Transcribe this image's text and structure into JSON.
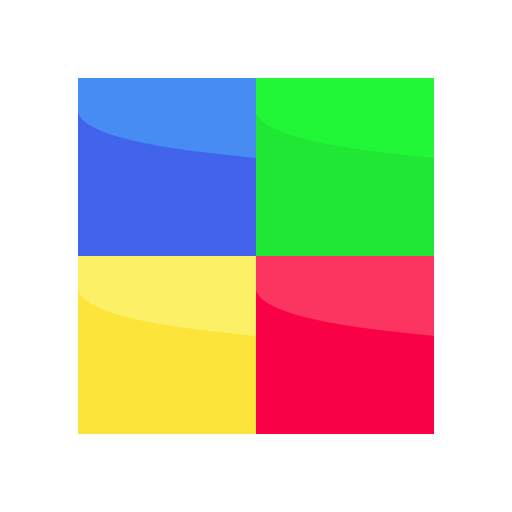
{
  "app_icon": {
    "icon": "four-color-squares-logo-icon",
    "tiles": [
      {
        "position": "top-left",
        "color": "#4263EB",
        "highlight": "#468CF3"
      },
      {
        "position": "top-right",
        "color": "#20E635",
        "highlight": "#22F737"
      },
      {
        "position": "bottom-left",
        "color": "#FCE43A",
        "highlight": "#FCF066"
      },
      {
        "position": "bottom-right",
        "color": "#FA0046",
        "highlight": "#FB3460"
      }
    ]
  }
}
